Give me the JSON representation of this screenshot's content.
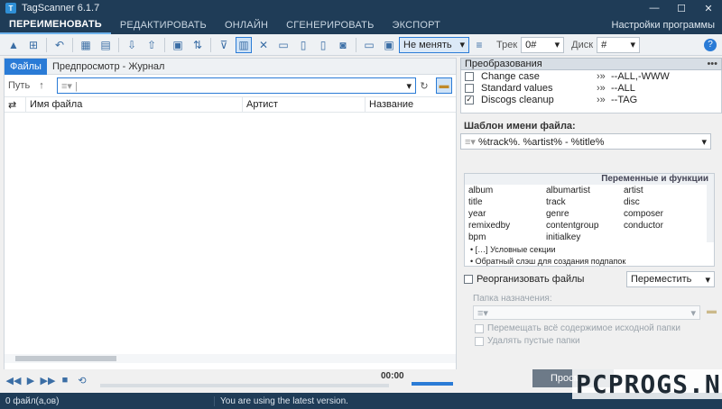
{
  "window": {
    "title": "TagScanner 6.1.7",
    "minimize": "—",
    "maximize": "☐",
    "close": "✕"
  },
  "tabs": [
    "ПЕРЕИМЕНОВАТЬ",
    "РЕДАКТИРОВАТЬ",
    "ОНЛАЙН",
    "СГЕНЕРИРОВАТЬ",
    "ЭКСПОРТ"
  ],
  "settings_link": "Настройки программы",
  "toolbar": {
    "mode_select": "Не менять",
    "track_label": "Трек",
    "track_value": "0#",
    "disk_label": "Диск",
    "disk_value": "#"
  },
  "left": {
    "tabs": [
      "Файлы",
      "Предпросмотр - Журнал"
    ],
    "path_label": "Путь",
    "columns": [
      "Имя файла",
      "Артист",
      "Название"
    ]
  },
  "player": {
    "time": "00:00"
  },
  "transforms": {
    "header": "Преобразования",
    "items": [
      {
        "checked": "",
        "name": "Change case",
        "value": "--ALL,-WWW"
      },
      {
        "checked": "",
        "name": "Standard values",
        "value": "--ALL"
      },
      {
        "checked": "✓",
        "name": "Discogs cleanup",
        "value": "--TAG"
      }
    ]
  },
  "template": {
    "title": "Шаблон имени файла:",
    "value": "%track%. %artist% - %title%"
  },
  "variables": {
    "title": "Переменные и функции",
    "items": [
      "album",
      "albumartist",
      "artist",
      "title",
      "track",
      "disc",
      "year",
      "genre",
      "composer",
      "remixedby",
      "contentgroup",
      "conductor",
      "bpm",
      "initialkey"
    ],
    "notes": [
      "• […] Условные секции",
      "• Обратный слэш для создания подпапок"
    ]
  },
  "reorganize": {
    "label": "Реорганизовать файлы",
    "action": "Переместить",
    "dest_label": "Папка назначения:",
    "option1": "Перемещать всё содержимое исходной папки",
    "option2": "Удалять пустые папки"
  },
  "preview_button": "Просм",
  "status": {
    "files": "0 файл(а,ов)",
    "message": "You are using the latest version."
  },
  "watermark": "PCPROGS.NET"
}
